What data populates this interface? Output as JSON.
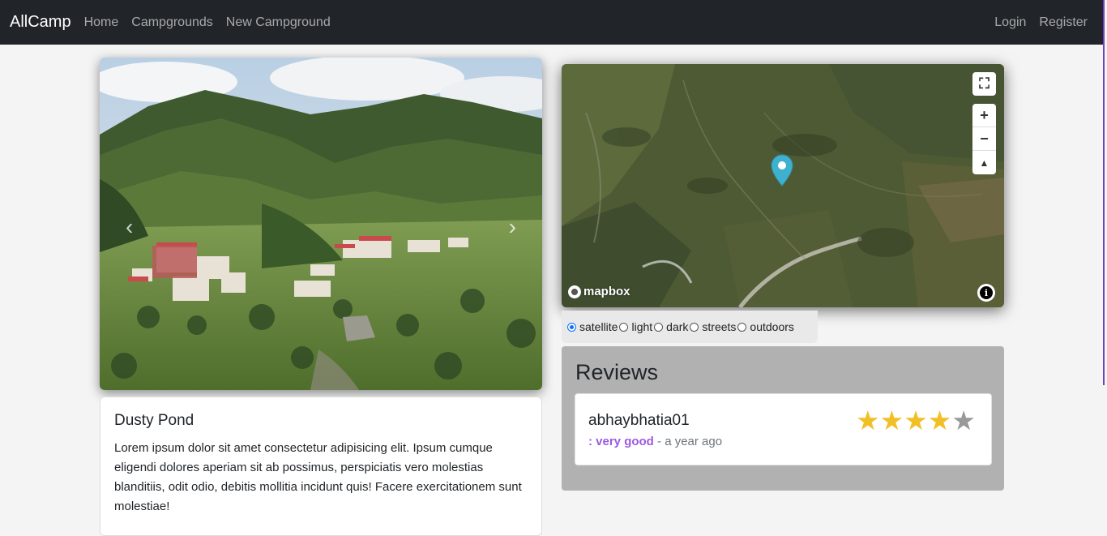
{
  "navbar": {
    "brand": "AllCamp",
    "links": [
      "Home",
      "Campgrounds",
      "New Campground"
    ],
    "right_links": [
      "Login",
      "Register"
    ]
  },
  "carousel": {
    "prev_icon": "chevron-left-icon",
    "next_icon": "chevron-right-icon"
  },
  "campground": {
    "title": "Dusty Pond",
    "description": "Lorem ipsum dolor sit amet consectetur adipisicing elit. Ipsum cumque eligendi dolores aperiam sit ab possimus, perspiciatis vero molestias blanditiis, odit odio, debitis mollitia incidunt quis! Facere exercitationem sunt molestiae!"
  },
  "map": {
    "logo_text": "mapbox",
    "controls": {
      "fullscreen": "⛶",
      "zoom_in": "+",
      "zoom_out": "−",
      "compass": "▲"
    },
    "info_icon": "i",
    "marker_color": "#3fb1ce",
    "styles": [
      "satellite",
      "light",
      "dark",
      "streets",
      "outdoors"
    ],
    "selected_style": "satellite"
  },
  "reviews": {
    "title": "Reviews",
    "items": [
      {
        "author": "abhaybhatia01",
        "rating": 4,
        "max_rating": 5,
        "text": ": very good",
        "time": " - a year ago"
      }
    ]
  },
  "colors": {
    "navbar": "#212529",
    "star_on": "#f1c027",
    "star_off": "#999999",
    "review_text": "#9b59e3",
    "reviews_bg": "#b1b1b1"
  }
}
